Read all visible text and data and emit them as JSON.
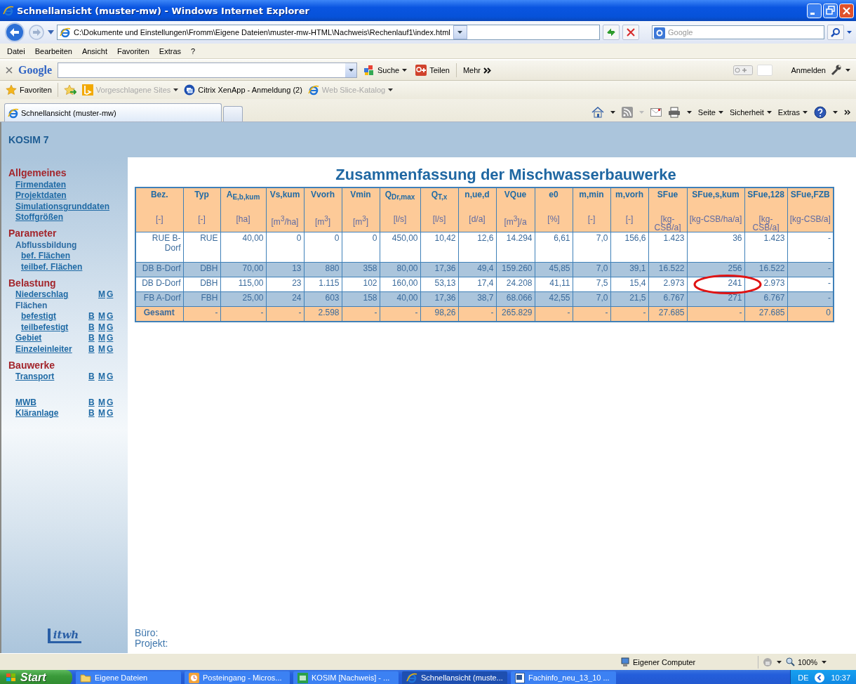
{
  "window": {
    "title": "Schnellansicht (muster-mw) - Windows Internet Explorer"
  },
  "address_bar": {
    "url": "C:\\Dokumente und Einstellungen\\Fromm\\Eigene Dateien\\muster-mw-HTML\\Nachweis\\Rechenlauf1\\index.html",
    "search_placeholder": "Google"
  },
  "menu": [
    "Datei",
    "Bearbeiten",
    "Ansicht",
    "Favoriten",
    "Extras",
    "?"
  ],
  "google_toolbar": {
    "logo": "Google",
    "buttons": [
      "Suche",
      "Teilen",
      "Mehr"
    ],
    "sign_in": "Anmelden"
  },
  "favorites_bar": {
    "label": "Favoriten",
    "items": [
      {
        "label": "Vorgeschlagene Sites",
        "disabled": true
      },
      {
        "label": "Citrix XenApp - Anmeldung (2)",
        "disabled": false
      },
      {
        "label": "Web Slice-Katalog",
        "disabled": true
      }
    ]
  },
  "tabs": [
    {
      "label": "Schnellansicht (muster-mw)",
      "selected": true
    }
  ],
  "command_bar": [
    "Seite",
    "Sicherheit",
    "Extras"
  ],
  "app": {
    "title": "KOSIM 7",
    "sidebar": [
      {
        "title": "Allgemeines",
        "items": [
          {
            "label": "Firmendaten",
            "kind": "link"
          },
          {
            "label": "Projektdaten",
            "kind": "link"
          },
          {
            "label": "Simulationsgrunddaten",
            "kind": "link"
          },
          {
            "label": "Stoffgrößen",
            "kind": "link"
          }
        ]
      },
      {
        "title": "Parameter",
        "items": [
          {
            "label": "Abflussbildung",
            "kind": "heading",
            "children": [
              {
                "label": "bef. Flächen",
                "kind": "link"
              },
              {
                "label": "teilbef. Flächen",
                "kind": "link"
              }
            ]
          }
        ]
      },
      {
        "title": "Belastung",
        "items": [
          {
            "label": "Niederschlag",
            "kind": "link",
            "links": [
              "M",
              "G"
            ]
          },
          {
            "label": "Flächen",
            "kind": "heading",
            "children": [
              {
                "label": "befestigt",
                "kind": "link",
                "links": [
                  "B",
                  "M",
                  "G"
                ]
              },
              {
                "label": "teilbefestigt",
                "kind": "link",
                "links": [
                  "B",
                  "M",
                  "G"
                ]
              }
            ]
          },
          {
            "label": "Gebiet",
            "kind": "link",
            "links": [
              "B",
              "M",
              "G"
            ]
          },
          {
            "label": "Einzeleinleiter",
            "kind": "link",
            "links": [
              "B",
              "M",
              "G"
            ]
          }
        ]
      },
      {
        "title": "Bauwerke",
        "items": [
          {
            "label": "Transport",
            "kind": "link",
            "links": [
              "B",
              "M",
              "G"
            ]
          }
        ]
      },
      {
        "items": [
          {
            "label": "MWB",
            "kind": "link",
            "links": [
              "B",
              "M",
              "G"
            ]
          },
          {
            "label": "Kläranlage",
            "kind": "link",
            "links": [
              "B",
              "M",
              "G"
            ]
          }
        ]
      }
    ],
    "logo": "itwh",
    "footer": [
      "Büro:",
      "Projekt:"
    ]
  },
  "table": {
    "title": "Zusammenfassung der Mischwasserbauwerke",
    "columns": [
      {
        "label": "Bez.",
        "unit": "[-]",
        "circled": false
      },
      {
        "label": "Typ",
        "unit": "[-]",
        "circled": false
      },
      {
        "label": "A$_{E,b,kum}$",
        "unit": "[ha]",
        "circled": false
      },
      {
        "label": "Vs,kum",
        "unit": "[m$^{3}$/ha]",
        "circled": false
      },
      {
        "label": "Vvorh",
        "unit": "[m$^{3}$]",
        "circled": false
      },
      {
        "label": "Vmin",
        "unit": "[m$^{3}$]",
        "circled": false
      },
      {
        "label": "Q$_{Dr,max}$",
        "unit": "[l/s]",
        "circled": false
      },
      {
        "label": "Q$_{T,x}$",
        "unit": "[l/s]",
        "circled": false
      },
      {
        "label": "n,ue,d",
        "unit": "[d/a]",
        "circled": false
      },
      {
        "label": "VQue",
        "unit": "[m$^{3}$]/a",
        "circled": false
      },
      {
        "label": "e0",
        "unit": "[%]",
        "circled": false
      },
      {
        "label": "m,min",
        "unit": "[-]",
        "circled": false
      },
      {
        "label": "m,vorh",
        "unit": "[-]",
        "circled": false
      },
      {
        "label": "SFue",
        "unit": "[kg-CSB/a]",
        "circled": false
      },
      {
        "label": "SFue,s,kum",
        "unit": "[kg-CSB/ha/a]",
        "circled": true
      },
      {
        "label": "SFue,128",
        "unit": "[kg-CSB/a]",
        "circled": false
      },
      {
        "label": "SFue,FZB",
        "unit": "[kg-CSB/a]",
        "circled": false
      }
    ],
    "rows": [
      {
        "kind": "plain",
        "circled": false,
        "cells": [
          "RUE B-Dorf",
          "RUE",
          "40,00",
          "0",
          "0",
          "0",
          "450,00",
          "10,42",
          "12,6",
          "14.294",
          "6,61",
          "7,0",
          "156,6",
          "1.423",
          "36",
          "1.423",
          "-"
        ]
      },
      {
        "kind": "shaded",
        "circled": false,
        "cells": [
          "DB B-Dorf",
          "DBH",
          "70,00",
          "13",
          "880",
          "358",
          "80,00",
          "17,36",
          "49,4",
          "159.260",
          "45,85",
          "7,0",
          "39,1",
          "16.522",
          "256",
          "16.522",
          "-"
        ]
      },
      {
        "kind": "plain",
        "circled": true,
        "cells": [
          "DB D-Dorf",
          "DBH",
          "115,00",
          "23",
          "1.115",
          "102",
          "160,00",
          "53,13",
          "17,4",
          "24.208",
          "41,11",
          "7,5",
          "15,4",
          "2.973",
          "241",
          "2.973",
          "-"
        ]
      },
      {
        "kind": "shaded",
        "circled": false,
        "cells": [
          "FB A-Dorf",
          "FBH",
          "25,00",
          "24",
          "603",
          "158",
          "40,00",
          "17,36",
          "38,7",
          "68.066",
          "42,55",
          "7,0",
          "21,5",
          "6.767",
          "271",
          "6.767",
          "-"
        ]
      },
      {
        "kind": "total",
        "circled": false,
        "cells": [
          "Gesamt",
          "-",
          "-",
          "-",
          "2.598",
          "-",
          "-",
          "98,26",
          "-",
          "265.829",
          "-",
          "-",
          "-",
          "27.685",
          "-",
          "27.685",
          "0"
        ]
      }
    ]
  },
  "status_bar": {
    "zone": "Eigener Computer",
    "zoom": "100%"
  },
  "taskbar": {
    "start": "Start",
    "items": [
      {
        "label": "Eigene Dateien",
        "selected": false
      },
      {
        "label": "Posteingang - Micros...",
        "selected": false
      },
      {
        "label": "KOSIM [Nachweis] - ...",
        "selected": false
      },
      {
        "label": "Schnellansicht (muste...",
        "selected": true
      },
      {
        "label": "Fachinfo_neu_13_10 ...",
        "selected": false
      }
    ],
    "language": "DE",
    "clock": "10:37"
  }
}
